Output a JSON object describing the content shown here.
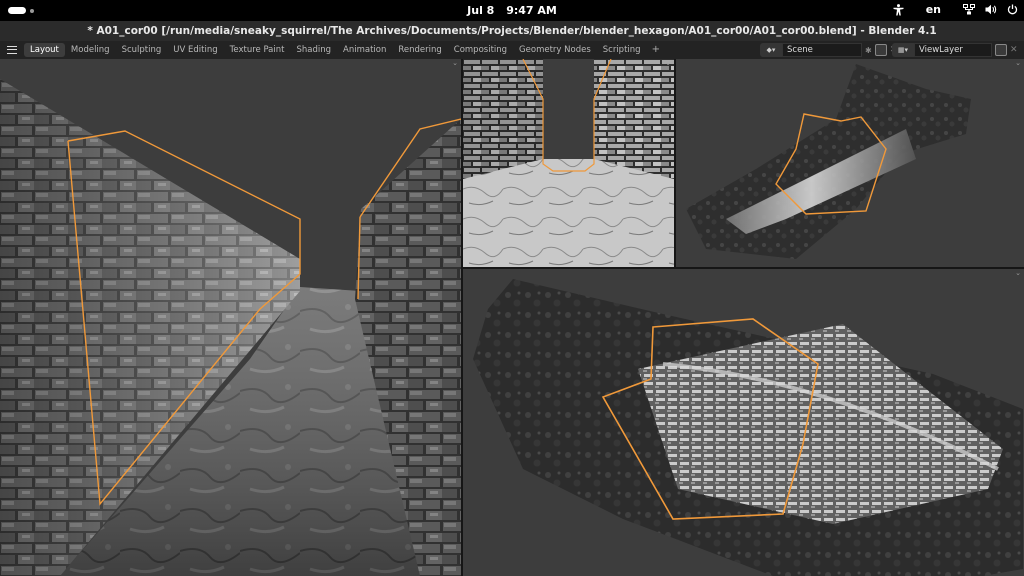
{
  "system_bar": {
    "date": "Jul 8",
    "time": "9:47 AM",
    "language": "en",
    "icons": [
      "activities-indicator",
      "accessibility-icon",
      "network-icon",
      "volume-icon",
      "power-icon"
    ]
  },
  "window": {
    "title": "* A01_cor00 [/run/media/sneaky_squirrel/The Archives/Documents/Projects/Blender/blender_hexagon/A01_cor00/A01_cor00.blend] - Blender 4.1"
  },
  "header": {
    "menu_icon": "hamburger-menu-icon",
    "tabs": [
      {
        "label": "Layout",
        "active": true
      },
      {
        "label": "Modeling",
        "active": false
      },
      {
        "label": "Sculpting",
        "active": false
      },
      {
        "label": "UV Editing",
        "active": false
      },
      {
        "label": "Texture Paint",
        "active": false
      },
      {
        "label": "Shading",
        "active": false
      },
      {
        "label": "Animation",
        "active": false
      },
      {
        "label": "Rendering",
        "active": false
      },
      {
        "label": "Compositing",
        "active": false
      },
      {
        "label": "Geometry Nodes",
        "active": false
      },
      {
        "label": "Scripting",
        "active": false
      }
    ],
    "add_tab": "+",
    "scene": {
      "icon": "scene-icon",
      "value": "Scene"
    },
    "view_layer": {
      "icon": "view-layer-icon",
      "value": "ViewLayer"
    }
  },
  "colors": {
    "selection_outline": "#f0993a",
    "viewport_background": "#3d3d3d",
    "topbar": "#000000",
    "titlebar": "#2b2b2b"
  },
  "viewports": [
    {
      "name": "corridor-perspective-view",
      "content": "stone corridor seen from inside"
    },
    {
      "name": "corridor-front-view",
      "content": "stone corridor looking down its length"
    },
    {
      "name": "hexagon-top-view",
      "content": "hexagon tile with corridor, seen from above"
    },
    {
      "name": "hexagon-angled-view",
      "content": "hexagon tile with corridor, angled close-up"
    }
  ]
}
